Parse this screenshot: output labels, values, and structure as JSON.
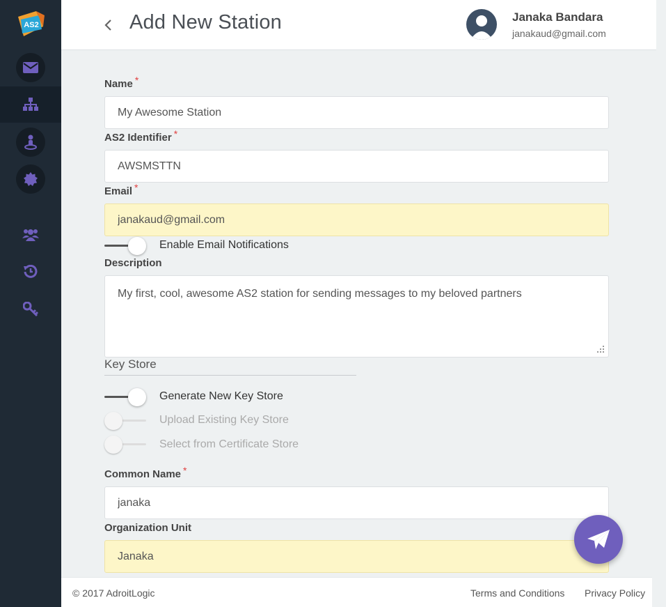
{
  "app": {
    "logo_text": "AS2"
  },
  "sidebar": {
    "items": [
      {
        "icon": "envelope-icon"
      },
      {
        "icon": "sitemap-icon"
      },
      {
        "icon": "user-pin-icon"
      },
      {
        "icon": "badge-icon"
      },
      {
        "icon": "users-icon"
      },
      {
        "icon": "history-icon"
      },
      {
        "icon": "key-icon"
      }
    ],
    "accent": "#6f5fbd",
    "active_index": 1
  },
  "header": {
    "title": "Add New Station",
    "user_name": "Janaka Bandara",
    "user_email": "janakaud@gmail.com"
  },
  "form": {
    "name": {
      "label": "Name",
      "required_mark": "*",
      "value": "My Awesome Station"
    },
    "as2_identifier": {
      "label": "AS2 Identifier",
      "required_mark": "*",
      "value": "AWSMSTTN"
    },
    "email": {
      "label": "Email",
      "required_mark": "*",
      "value": "janakaud@gmail.com"
    },
    "email_notifications": {
      "label": "Enable Email Notifications",
      "enabled": true
    },
    "description": {
      "label": "Description",
      "value": "My first, cool, awesome AS2 station for sending messages to my beloved partners"
    },
    "key_store": {
      "section_title": "Key Store",
      "options": [
        {
          "label": "Generate New Key Store",
          "selected": true
        },
        {
          "label": "Upload Existing Key Store",
          "selected": false
        },
        {
          "label": "Select from Certificate Store",
          "selected": false
        }
      ]
    },
    "common_name": {
      "label": "Common Name",
      "required_mark": "*",
      "value": "janaka"
    },
    "organization_unit": {
      "label": "Organization Unit",
      "value": "Janaka"
    }
  },
  "fab": {
    "icon": "send-icon"
  },
  "footer": {
    "copyright": "© 2017 AdroitLogic",
    "terms": "Terms and Conditions",
    "privacy": "Privacy Policy"
  },
  "colors": {
    "sidebar_bg": "#1f2a35",
    "autofill_bg": "#fdf6c8",
    "required": "#e04040"
  }
}
